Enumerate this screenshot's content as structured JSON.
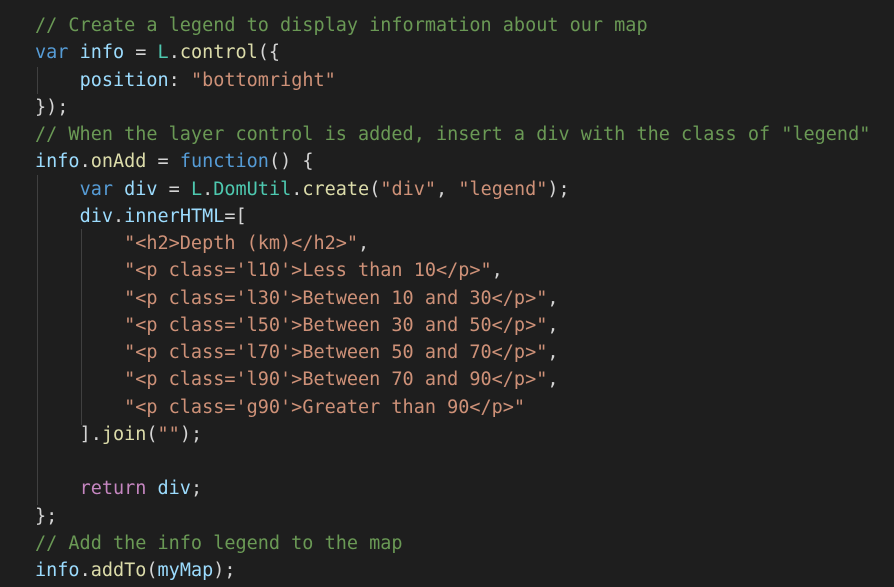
{
  "editor": {
    "colors": {
      "background": "#1e1e1e",
      "comment": "#6a9955",
      "keyword": "#569cd6",
      "control": "#c586c0",
      "variable": "#9cdcfe",
      "type": "#4ec9b0",
      "function": "#dcdcaa",
      "string": "#ce9178",
      "plain": "#d4d4d4"
    },
    "lines": [
      [
        {
          "t": "// Create a legend to display information about our map",
          "c": "comment"
        }
      ],
      [
        {
          "t": "var",
          "c": "keyword"
        },
        {
          "t": " ",
          "c": "plain"
        },
        {
          "t": "info",
          "c": "var"
        },
        {
          "t": " = ",
          "c": "plain"
        },
        {
          "t": "L",
          "c": "type"
        },
        {
          "t": ".",
          "c": "plain"
        },
        {
          "t": "control",
          "c": "func"
        },
        {
          "t": "({",
          "c": "plain"
        }
      ],
      [
        {
          "t": "    ",
          "c": "plain"
        },
        {
          "t": "position",
          "c": "var"
        },
        {
          "t": ": ",
          "c": "plain"
        },
        {
          "t": "\"bottomright\"",
          "c": "string"
        }
      ],
      [
        {
          "t": "});",
          "c": "plain"
        }
      ],
      [
        {
          "t": "// When the layer control is added, insert a div with the class of \"legend\"",
          "c": "comment"
        }
      ],
      [
        {
          "t": "info",
          "c": "var"
        },
        {
          "t": ".",
          "c": "plain"
        },
        {
          "t": "onAdd",
          "c": "func"
        },
        {
          "t": " = ",
          "c": "plain"
        },
        {
          "t": "function",
          "c": "keyword"
        },
        {
          "t": "() {",
          "c": "plain"
        }
      ],
      [
        {
          "t": "    ",
          "c": "plain"
        },
        {
          "t": "var",
          "c": "keyword"
        },
        {
          "t": " ",
          "c": "plain"
        },
        {
          "t": "div",
          "c": "var"
        },
        {
          "t": " = ",
          "c": "plain"
        },
        {
          "t": "L",
          "c": "type"
        },
        {
          "t": ".",
          "c": "plain"
        },
        {
          "t": "DomUtil",
          "c": "type"
        },
        {
          "t": ".",
          "c": "plain"
        },
        {
          "t": "create",
          "c": "func"
        },
        {
          "t": "(",
          "c": "plain"
        },
        {
          "t": "\"div\"",
          "c": "string"
        },
        {
          "t": ", ",
          "c": "plain"
        },
        {
          "t": "\"legend\"",
          "c": "string"
        },
        {
          "t": ");",
          "c": "plain"
        }
      ],
      [
        {
          "t": "    ",
          "c": "plain"
        },
        {
          "t": "div",
          "c": "var"
        },
        {
          "t": ".",
          "c": "plain"
        },
        {
          "t": "innerHTML",
          "c": "var"
        },
        {
          "t": "=[",
          "c": "plain"
        }
      ],
      [
        {
          "t": "        ",
          "c": "plain"
        },
        {
          "t": "\"<h2>Depth (km)</h2>\"",
          "c": "string"
        },
        {
          "t": ",",
          "c": "plain"
        }
      ],
      [
        {
          "t": "        ",
          "c": "plain"
        },
        {
          "t": "\"<p class='l10'>Less than 10</p>\"",
          "c": "string"
        },
        {
          "t": ",",
          "c": "plain"
        }
      ],
      [
        {
          "t": "        ",
          "c": "plain"
        },
        {
          "t": "\"<p class='l30'>Between 10 and 30</p>\"",
          "c": "string"
        },
        {
          "t": ",",
          "c": "plain"
        }
      ],
      [
        {
          "t": "        ",
          "c": "plain"
        },
        {
          "t": "\"<p class='l50'>Between 30 and 50</p>\"",
          "c": "string"
        },
        {
          "t": ",",
          "c": "plain"
        }
      ],
      [
        {
          "t": "        ",
          "c": "plain"
        },
        {
          "t": "\"<p class='l70'>Between 50 and 70</p>\"",
          "c": "string"
        },
        {
          "t": ",",
          "c": "plain"
        }
      ],
      [
        {
          "t": "        ",
          "c": "plain"
        },
        {
          "t": "\"<p class='l90'>Between 70 and 90</p>\"",
          "c": "string"
        },
        {
          "t": ",",
          "c": "plain"
        }
      ],
      [
        {
          "t": "        ",
          "c": "plain"
        },
        {
          "t": "\"<p class='g90'>Greater than 90</p>\"",
          "c": "string"
        }
      ],
      [
        {
          "t": "    ",
          "c": "plain"
        },
        {
          "t": "].",
          "c": "plain"
        },
        {
          "t": "join",
          "c": "func"
        },
        {
          "t": "(",
          "c": "plain"
        },
        {
          "t": "\"\"",
          "c": "string"
        },
        {
          "t": ");",
          "c": "plain"
        }
      ],
      [],
      [
        {
          "t": "    ",
          "c": "plain"
        },
        {
          "t": "return",
          "c": "control"
        },
        {
          "t": " ",
          "c": "plain"
        },
        {
          "t": "div",
          "c": "var"
        },
        {
          "t": ";",
          "c": "plain"
        }
      ],
      [
        {
          "t": "};",
          "c": "plain"
        }
      ],
      [
        {
          "t": "// Add the info legend to the map",
          "c": "comment"
        }
      ],
      [
        {
          "t": "info",
          "c": "var"
        },
        {
          "t": ".",
          "c": "plain"
        },
        {
          "t": "addTo",
          "c": "func"
        },
        {
          "t": "(",
          "c": "plain"
        },
        {
          "t": "myMap",
          "c": "var"
        },
        {
          "t": ");",
          "c": "plain"
        }
      ]
    ]
  }
}
